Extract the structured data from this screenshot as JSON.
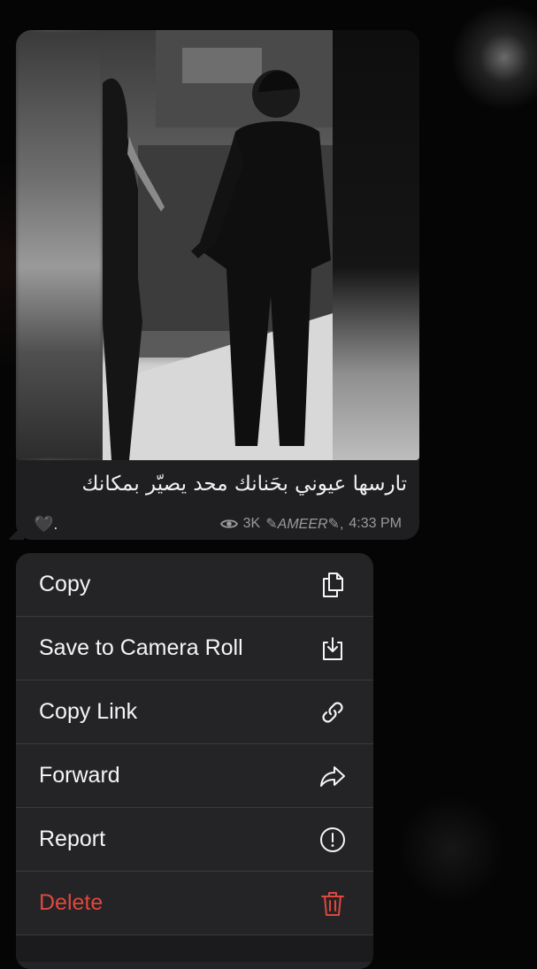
{
  "message": {
    "caption": "تارسها عيوني بحَنانك محد يصيّر بمكانك",
    "caption_tail": "🖤.",
    "views": "3K",
    "author": "AMEER",
    "time": "4:33 PM",
    "icons": {
      "views": "eye-icon",
      "heart": "black-heart-icon"
    }
  },
  "context_menu": {
    "items": [
      {
        "label": "Copy",
        "icon": "copy-icon"
      },
      {
        "label": "Save to Camera Roll",
        "icon": "download-icon"
      },
      {
        "label": "Copy Link",
        "icon": "link-icon"
      },
      {
        "label": "Forward",
        "icon": "forward-icon"
      },
      {
        "label": "Report",
        "icon": "report-icon"
      },
      {
        "label": "Delete",
        "icon": "trash-icon"
      }
    ],
    "colors": {
      "default": "#f5f5f5",
      "danger": "#e0473e"
    }
  }
}
